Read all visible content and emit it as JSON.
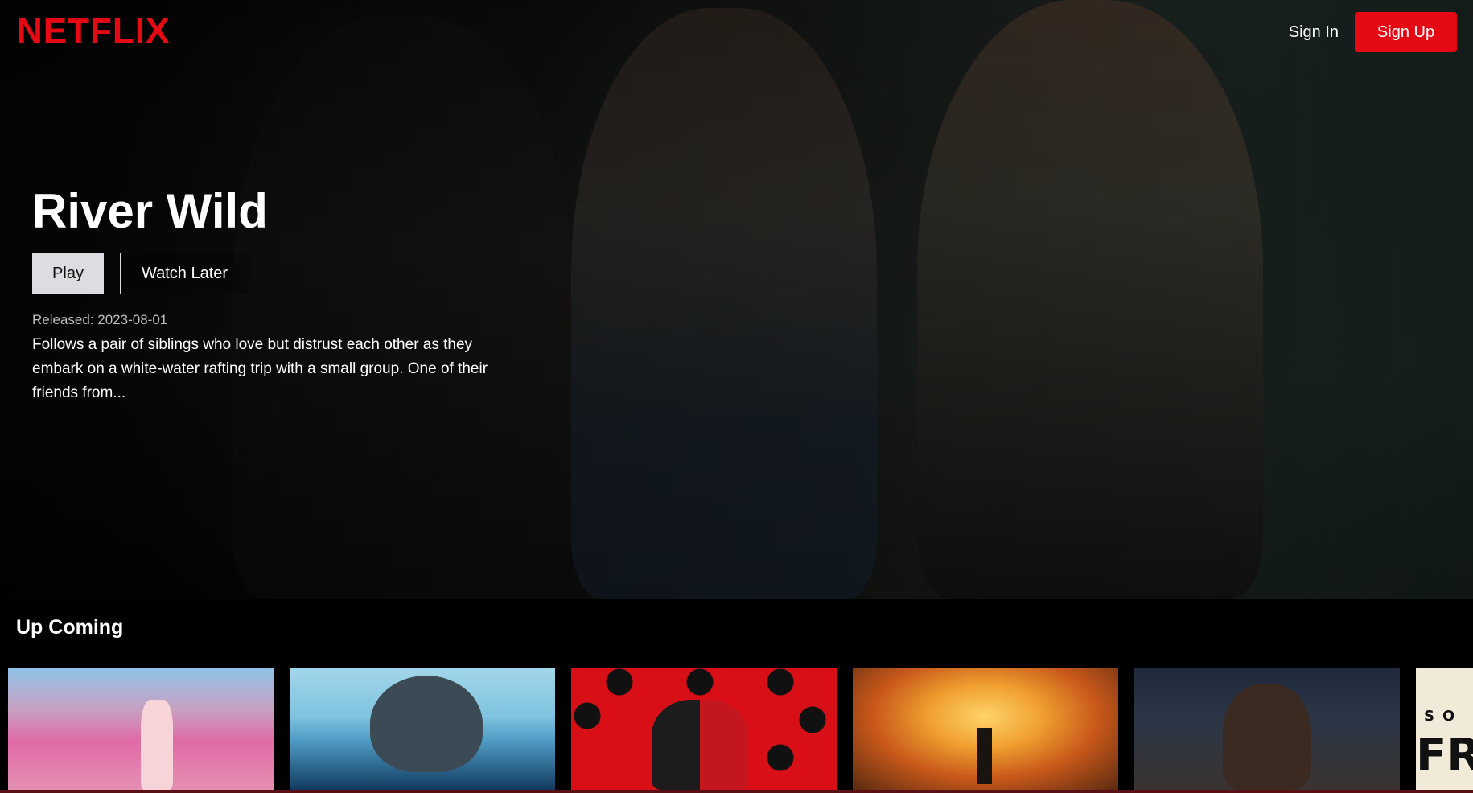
{
  "nav": {
    "logo": "NETFLIX",
    "sign_in": "Sign In",
    "sign_up": "Sign Up"
  },
  "hero": {
    "title": "River Wild",
    "play_label": "Play",
    "watch_later_label": "Watch Later",
    "released": "Released: 2023-08-01",
    "overview": "Follows a pair of siblings who love but distrust each other as they embark on a white-water rafting trip with a small group. One of their friends from..."
  },
  "upcoming": {
    "title": "Up Coming",
    "partial_card_text_top": "SO",
    "partial_card_text_big": "FRE"
  },
  "colors": {
    "brand": "#e50914",
    "background": "#000000",
    "play_button_bg": "#dcdde0"
  }
}
